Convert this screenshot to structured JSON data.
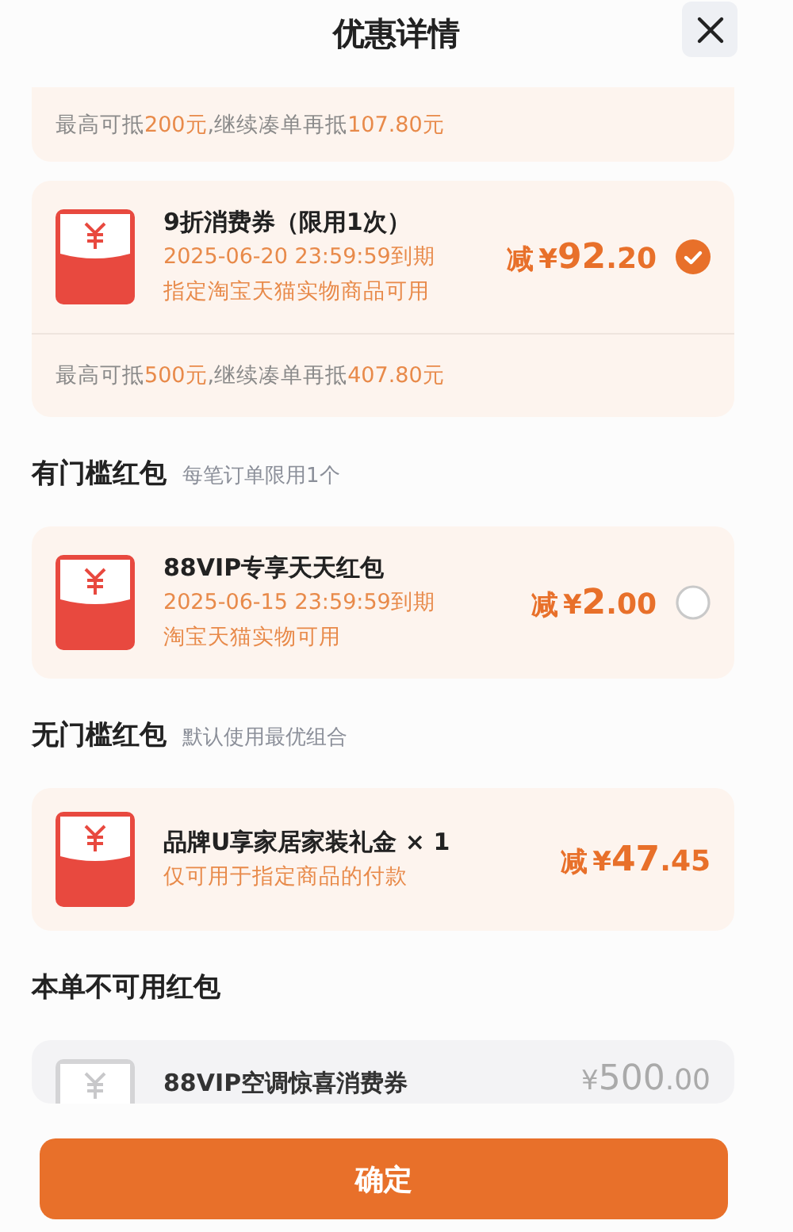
{
  "title": "优惠详情",
  "top_card": {
    "note": [
      {
        "text": "最高可抵",
        "highlight": false
      },
      {
        "text": "200元",
        "highlight": true
      },
      {
        "text": ",继续凑单再抵",
        "highlight": false
      },
      {
        "text": "107.80元",
        "highlight": true
      }
    ]
  },
  "sections": [
    {
      "coupons": [
        {
          "kind": "available",
          "title": "9折消费券（限用1次）",
          "lines": [
            "2025-06-20 23:59:59到期",
            "指定淘宝天猫实物商品可用"
          ],
          "prefix": "减",
          "currency": "¥",
          "amount": "92",
          "decimal": ".20",
          "selected": true,
          "note": [
            {
              "text": "最高可抵",
              "highlight": false
            },
            {
              "text": "500元",
              "highlight": true
            },
            {
              "text": ",继续凑单再抵",
              "highlight": false
            },
            {
              "text": "407.80元",
              "highlight": true
            }
          ]
        }
      ]
    },
    {
      "heading": "有门槛红包",
      "subheading": "每笔订单限用1个",
      "coupons": [
        {
          "kind": "available",
          "title": "88VIP专享天天红包",
          "lines": [
            "2025-06-15 23:59:59到期",
            "淘宝天猫实物可用"
          ],
          "prefix": "减",
          "currency": "¥",
          "amount": "2",
          "decimal": ".00",
          "selected": false
        }
      ]
    },
    {
      "heading": "无门槛红包",
      "subheading": "默认使用最优组合",
      "coupons": [
        {
          "kind": "available",
          "title": "品牌U享家居家装礼金 × 1",
          "lines": [
            "仅可用于指定商品的付款"
          ],
          "prefix": "减",
          "currency": "¥",
          "amount": "47",
          "decimal": ".45"
        }
      ]
    },
    {
      "heading": "本单不可用红包",
      "coupons": [
        {
          "kind": "disabled",
          "title": "88VIP空调惊喜消费券",
          "currency": "¥",
          "amount": "500",
          "decimal": ".00"
        }
      ]
    }
  ],
  "confirm_button": "确定"
}
